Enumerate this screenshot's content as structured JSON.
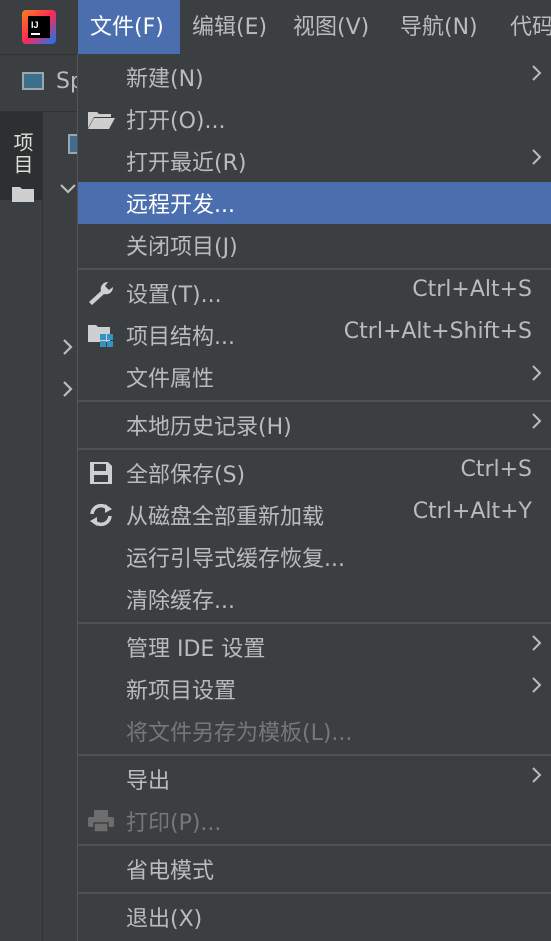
{
  "menubar": {
    "items": [
      {
        "label": "文件(F)"
      },
      {
        "label": "编辑(E)"
      },
      {
        "label": "视图(V)"
      },
      {
        "label": "导航(N)"
      },
      {
        "label": "代码"
      }
    ]
  },
  "nav": {
    "label": "Sp"
  },
  "tool_window": {
    "label": "项目"
  },
  "file_menu": {
    "items": [
      {
        "label": "新建(N)"
      },
      {
        "label": "打开(O)..."
      },
      {
        "label": "打开最近(R)"
      },
      {
        "label": "远程开发..."
      },
      {
        "label": "关闭项目(J)"
      },
      {
        "label": "设置(T)...",
        "shortcut": "Ctrl+Alt+S"
      },
      {
        "label": "项目结构...",
        "shortcut": "Ctrl+Alt+Shift+S"
      },
      {
        "label": "文件属性"
      },
      {
        "label": "本地历史记录(H)"
      },
      {
        "label": "全部保存(S)",
        "shortcut": "Ctrl+S"
      },
      {
        "label": "从磁盘全部重新加载",
        "shortcut": "Ctrl+Alt+Y"
      },
      {
        "label": "运行引导式缓存恢复..."
      },
      {
        "label": "清除缓存..."
      },
      {
        "label": "管理 IDE 设置"
      },
      {
        "label": "新项目设置"
      },
      {
        "label": "将文件另存为模板(L)..."
      },
      {
        "label": "导出"
      },
      {
        "label": "打印(P)..."
      },
      {
        "label": "省电模式"
      },
      {
        "label": "退出(X)"
      }
    ]
  },
  "colors": {
    "selection": "#4b6eaf",
    "background": "#3c3f41",
    "text": "#bbbbbb",
    "disabled_text": "#777777"
  }
}
